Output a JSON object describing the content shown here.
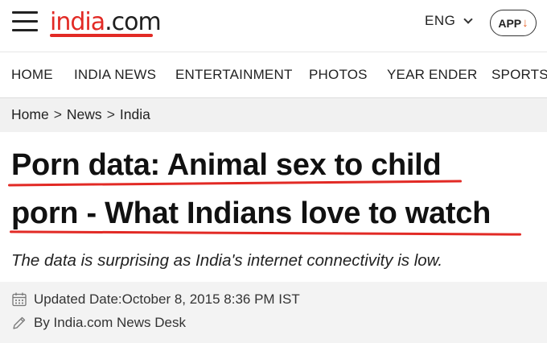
{
  "header": {
    "logo_part1": "india",
    "logo_part2": ".com",
    "language": "ENG",
    "app_label": "APP",
    "app_arrow": "↓",
    "brand_color": "#e22a25",
    "icons": [
      "hamburger-menu-icon",
      "chevron-down-icon",
      "download-arrow-icon"
    ]
  },
  "nav": {
    "items": [
      "HOME",
      "INDIA NEWS",
      "ENTERTAINMENT",
      "PHOTOS",
      "YEAR ENDER",
      "SPORTS"
    ]
  },
  "breadcrumb": {
    "items": [
      "Home",
      "News",
      "India"
    ],
    "separator": ">"
  },
  "article": {
    "title_line1": "Porn data: Animal sex to child",
    "title_line2": "porn - What Indians love to watch",
    "subtitle": "The data is surprising as India's internet connectivity is low.",
    "updated": "Updated Date:October 8, 2015 8:36 PM IST",
    "byline": "By India.com News Desk",
    "icons": [
      "calendar-icon",
      "pencil-icon"
    ]
  }
}
